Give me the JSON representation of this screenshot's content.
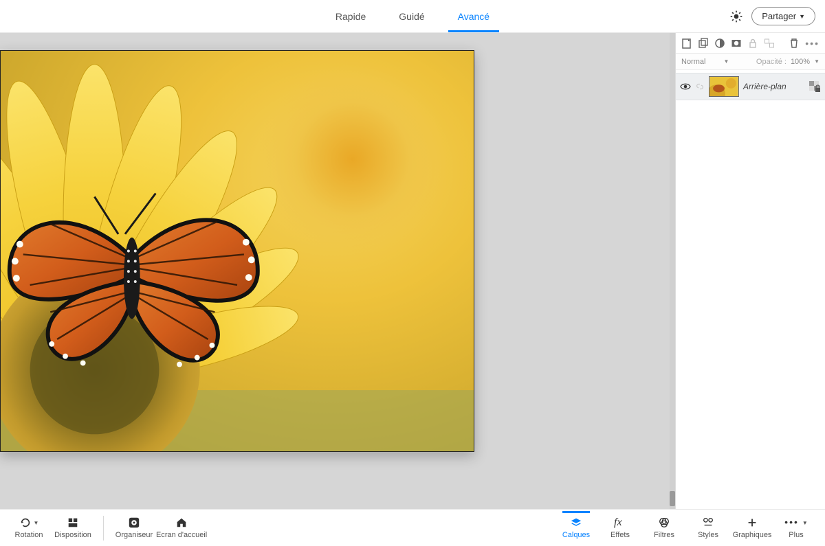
{
  "topbar": {
    "tabs": [
      {
        "label": "Rapide",
        "active": false
      },
      {
        "label": "Guidé",
        "active": false
      },
      {
        "label": "Avancé",
        "active": true
      }
    ],
    "share_label": "Partager"
  },
  "layers_panel": {
    "blend_mode": "Normal",
    "opacity_label": "Opacité :",
    "opacity_value": "100%",
    "layer_name": "Arrière-plan"
  },
  "bottombar": {
    "left": [
      {
        "key": "rotation",
        "label": "Rotation"
      },
      {
        "key": "disposition",
        "label": "Disposition"
      }
    ],
    "left2": [
      {
        "key": "organiseur",
        "label": "Organiseur"
      },
      {
        "key": "ecran",
        "label": "Ecran d'accueil"
      }
    ],
    "right": [
      {
        "key": "calques",
        "label": "Calques",
        "active": true
      },
      {
        "key": "effets",
        "label": "Effets",
        "active": false
      },
      {
        "key": "filtres",
        "label": "Filtres",
        "active": false
      },
      {
        "key": "styles",
        "label": "Styles",
        "active": false
      },
      {
        "key": "graphiques",
        "label": "Graphiques",
        "active": false
      },
      {
        "key": "plus",
        "label": "Plus",
        "active": false
      }
    ]
  }
}
